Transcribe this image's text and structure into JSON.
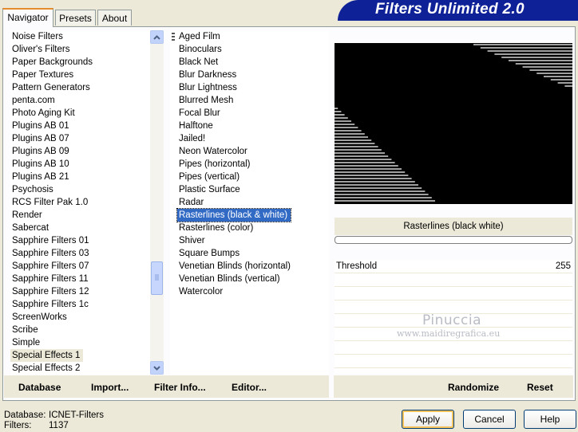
{
  "tabs": [
    {
      "label": "Navigator",
      "active": true
    },
    {
      "label": "Presets",
      "active": false
    },
    {
      "label": "About",
      "active": false
    }
  ],
  "banner_title": "Filters Unlimited 2.0",
  "categories": [
    "Noise Filters",
    "Oliver's Filters",
    "Paper Backgrounds",
    "Paper Textures",
    "Pattern Generators",
    "penta.com",
    "Photo Aging Kit",
    "Plugins AB 01",
    "Plugins AB 07",
    "Plugins AB 09",
    "Plugins AB 10",
    "Plugins AB 21",
    "Psychosis",
    "RCS Filter Pak 1.0",
    "Render",
    "Sabercat",
    "Sapphire Filters 01",
    "Sapphire Filters 03",
    "Sapphire Filters 07",
    "Sapphire Filters 11",
    "Sapphire Filters 12",
    "Sapphire Filters 1c",
    "ScreenWorks",
    "Scribe",
    "Simple",
    "Special Effects 1",
    "Special Effects 2"
  ],
  "selected_category": "Special Effects 1",
  "filters": [
    "Aged Film",
    "Binoculars",
    "Black Net",
    "Blur Darkness",
    "Blur Lightness",
    "Blurred Mesh",
    "Focal Blur",
    "Halftone",
    "Jailed!",
    "Neon Watercolor",
    "Pipes (horizontal)",
    "Pipes (vertical)",
    "Plastic Surface",
    "Radar",
    "Rasterlines (black & white)",
    "Rasterlines (color)",
    "Shiver",
    "Square Bumps",
    "Venetian Blinds (horizontal)",
    "Venetian Blinds (vertical)",
    "Watercolor"
  ],
  "selected_filter": "Rasterlines (black & white)",
  "preview_title": "Rasterlines (black  white)",
  "parameter": {
    "name": "Threshold",
    "value": "255"
  },
  "watermark": {
    "line1": "Pinuccia",
    "line2": "www.maidiregrafica.eu"
  },
  "bottom_buttons": {
    "database": "Database",
    "import": "Import...",
    "filter_info": "Filter Info...",
    "editor": "Editor...",
    "randomize": "Randomize",
    "reset": "Reset"
  },
  "status": {
    "database_label": "Database:",
    "database_value": "ICNET-Filters",
    "filters_label": "Filters:",
    "filters_value": "1137"
  },
  "dialog_buttons": {
    "apply": "Apply",
    "cancel": "Cancel",
    "help": "Help"
  },
  "colors": {
    "banner": "#0f2196",
    "selection": "#316ac5",
    "dialog": "#ece9d8"
  }
}
